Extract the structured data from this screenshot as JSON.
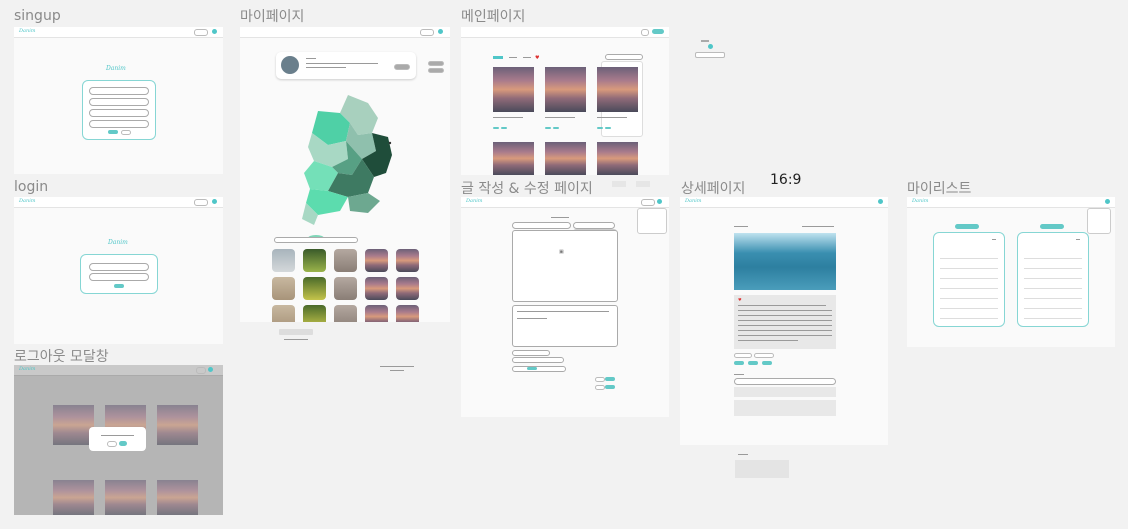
{
  "labels": {
    "signup": "singup",
    "mypage": "마이페이지",
    "main": "메인페이지",
    "login": "login",
    "write": "글 작성 & 수정 페이지",
    "detail": "상세페이지",
    "ratio": "16:9",
    "mylist": "마이리스트",
    "logout_modal": "로그아웃 모달창"
  },
  "brand": {
    "logo": "Danim"
  },
  "colors": {
    "accent": "#4fc6c8",
    "map_dark": "#1f4d3a",
    "modal_bg": "#b5b5b5"
  },
  "icons": [
    "map-icon",
    "heart-icon",
    "image-icon",
    "user-icon"
  ]
}
